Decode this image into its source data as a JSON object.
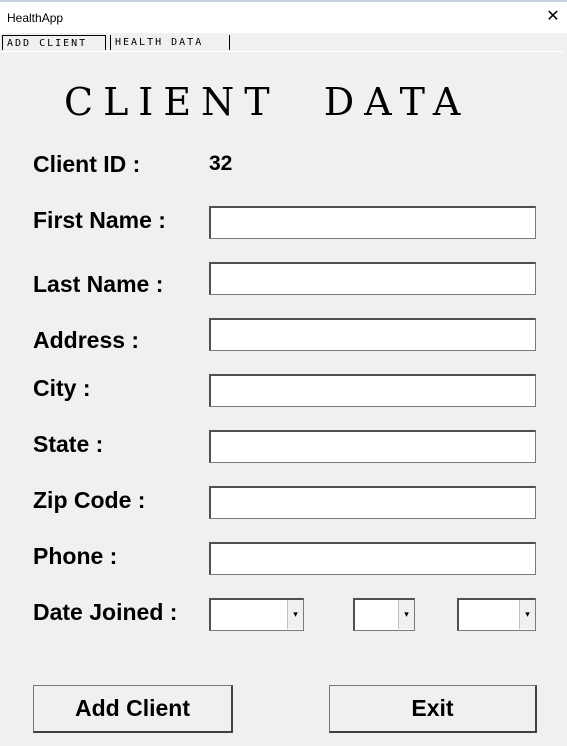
{
  "window": {
    "title": "HealthApp",
    "close_glyph": "✕"
  },
  "tabs": [
    {
      "label": "ADD CLIENT",
      "active": true
    },
    {
      "label": "HEALTH DATA",
      "active": false
    }
  ],
  "form": {
    "heading": "CLIENT DATA",
    "client_id": {
      "label": "Client ID :",
      "value": "32"
    },
    "fields": {
      "first_name": {
        "label": "First Name :",
        "value": ""
      },
      "last_name": {
        "label": "Last Name :",
        "value": ""
      },
      "address": {
        "label": "Address :",
        "value": ""
      },
      "city": {
        "label": "City :",
        "value": ""
      },
      "state": {
        "label": "State :",
        "value": ""
      },
      "zip_code": {
        "label": "Zip Code :",
        "value": ""
      },
      "phone": {
        "label": "Phone :",
        "value": ""
      }
    },
    "date_joined": {
      "label": "Date Joined :",
      "arrow_glyph": "▾"
    }
  },
  "buttons": {
    "add_client": "Add Client",
    "exit": "Exit"
  }
}
